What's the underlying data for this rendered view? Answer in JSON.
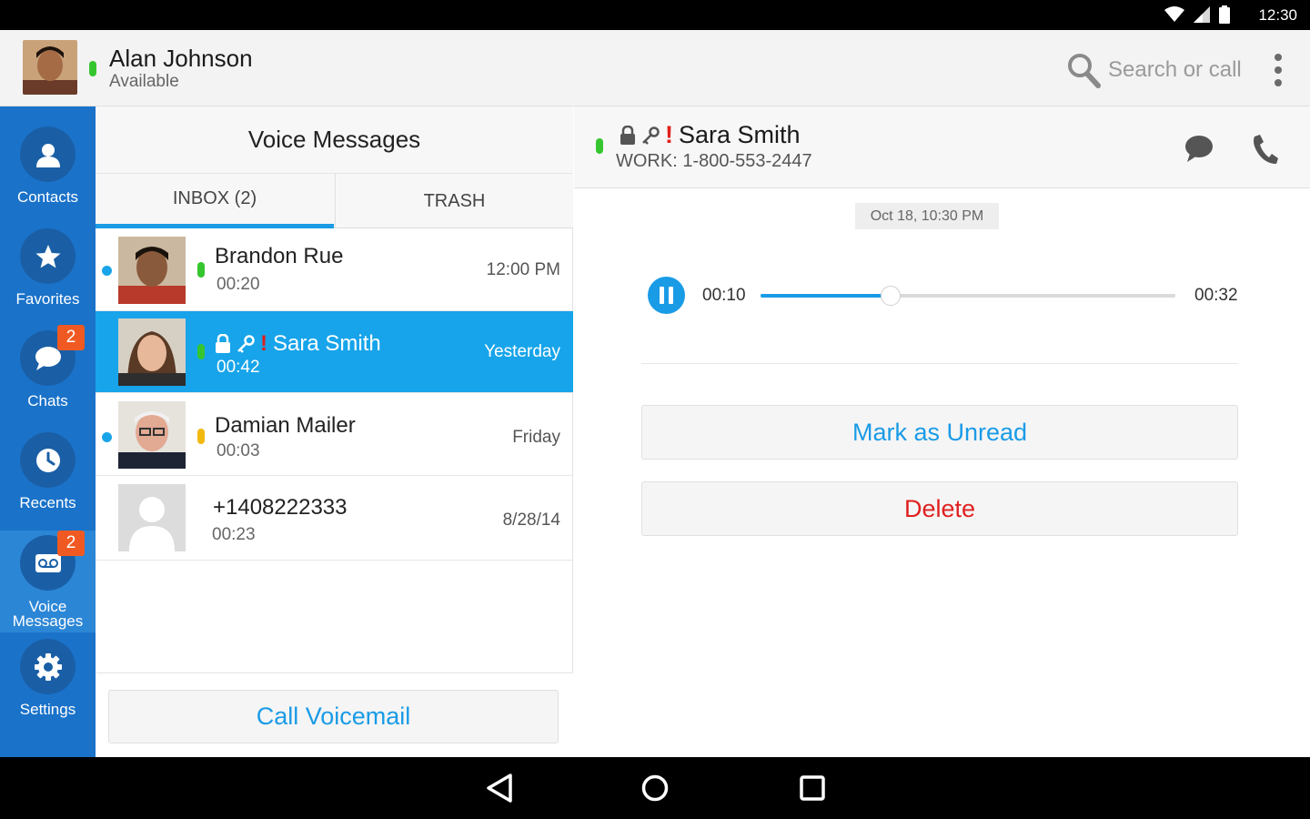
{
  "status_bar": {
    "time": "12:30"
  },
  "header": {
    "user_name": "Alan Johnson",
    "user_status": "Available",
    "search_placeholder": "Search or call"
  },
  "nav": {
    "items": [
      {
        "label": "Contacts",
        "icon": "person-icon"
      },
      {
        "label": "Favorites",
        "icon": "star-icon"
      },
      {
        "label": "Chats",
        "icon": "chat-icon",
        "badge": "2"
      },
      {
        "label": "Recents",
        "icon": "clock-icon"
      },
      {
        "label_line1": "Voice",
        "label_line2": "Messages",
        "icon": "voicemail-icon",
        "badge": "2",
        "active": true
      },
      {
        "label": "Settings",
        "icon": "gear-icon"
      }
    ]
  },
  "list": {
    "title": "Voice Messages",
    "tabs": {
      "inbox": "INBOX (2)",
      "trash": "TRASH"
    },
    "rows": [
      {
        "name": "Brandon Rue",
        "duration": "00:20",
        "time": "12:00 PM",
        "unread": true,
        "presence": "#35c62f"
      },
      {
        "name": "Sara Smith",
        "duration": "00:42",
        "time": "Yesterday",
        "unread": false,
        "presence": "#35c62f",
        "selected": true,
        "exclamation": "!"
      },
      {
        "name": "Damian Mailer",
        "duration": "00:03",
        "time": "Friday",
        "unread": true,
        "presence": "#f2b90f"
      },
      {
        "name": "+1408222333",
        "duration": "00:23",
        "time": "8/28/14",
        "unread": false
      }
    ],
    "footer_button": "Call Voicemail"
  },
  "detail": {
    "exclamation": "!",
    "name": "Sara Smith",
    "phone": "WORK: 1-800-553-2447",
    "date": "Oct 18, 10:30 PM",
    "current_time": "00:10",
    "total_time": "00:32",
    "progress_fraction": 0.3125,
    "mark_unread": "Mark as Unread",
    "delete": "Delete"
  },
  "colors": {
    "accent": "#1a9be6",
    "nav_bg": "#1a72c9",
    "badge": "#f05a22",
    "delete": "#e02020",
    "available": "#35c62f",
    "away": "#f2b90f"
  }
}
